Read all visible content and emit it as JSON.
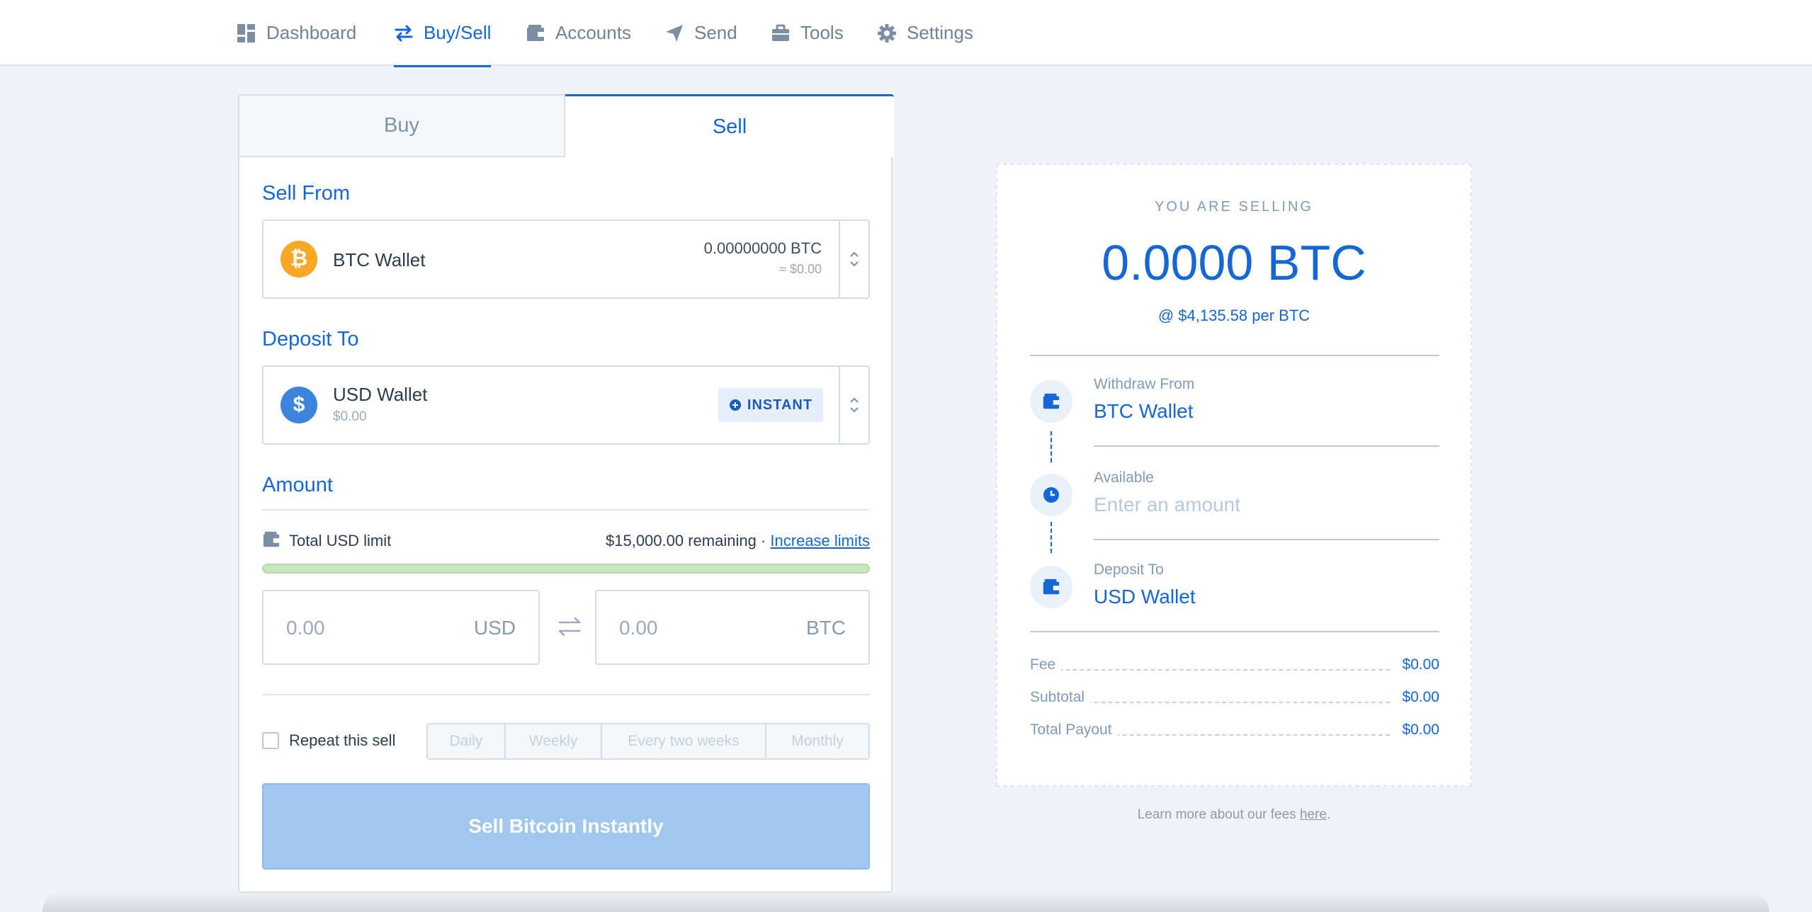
{
  "nav": {
    "items": [
      {
        "label": "Dashboard",
        "icon": "dashboard-icon"
      },
      {
        "label": "Buy/Sell",
        "icon": "exchange-icon",
        "active": true
      },
      {
        "label": "Accounts",
        "icon": "wallet-icon"
      },
      {
        "label": "Send",
        "icon": "paper-plane-icon"
      },
      {
        "label": "Tools",
        "icon": "briefcase-icon"
      },
      {
        "label": "Settings",
        "icon": "gear-icon"
      }
    ]
  },
  "tabs": {
    "buy": "Buy",
    "sell": "Sell",
    "active": "Sell"
  },
  "sell_from": {
    "title": "Sell From",
    "wallet": "BTC Wallet",
    "coin_symbol": "₿",
    "balance": "0.00000000 BTC",
    "balance_fiat": "≈ $0.00"
  },
  "deposit_to": {
    "title": "Deposit To",
    "wallet": "USD Wallet",
    "coin_symbol": "$",
    "balance": "$0.00",
    "badge": "INSTANT"
  },
  "amount": {
    "title": "Amount",
    "limit_label": "Total USD limit",
    "limit_remaining": "$15,000.00 remaining",
    "separator": "·",
    "increase_link": "Increase limits",
    "usd_value": "0.00",
    "usd_currency": "USD",
    "btc_value": "0.00",
    "btc_currency": "BTC"
  },
  "repeat": {
    "label": "Repeat this sell",
    "checked": false,
    "options": [
      "Daily",
      "Weekly",
      "Every two weeks",
      "Monthly"
    ]
  },
  "submit_label": "Sell Bitcoin Instantly",
  "summary": {
    "heading": "YOU ARE SELLING",
    "amount": "0.0000 BTC",
    "rate": "@ $4,135.58 per BTC",
    "steps": [
      {
        "label": "Withdraw From",
        "value": "BTC Wallet",
        "icon": "wallet-icon"
      },
      {
        "label": "Available",
        "value": "Enter an amount",
        "icon": "clock-icon",
        "placeholder": true
      },
      {
        "label": "Deposit To",
        "value": "USD Wallet",
        "icon": "wallet-icon"
      }
    ],
    "fees": [
      {
        "label": "Fee",
        "value": "$0.00"
      },
      {
        "label": "Subtotal",
        "value": "$0.00"
      },
      {
        "label": "Total Payout",
        "value": "$0.00"
      }
    ]
  },
  "footer": {
    "learn_more": "Learn more about our fees ",
    "link": "here",
    "period": "."
  },
  "colors": {
    "accent": "#1566d6",
    "background": "#eff3f7",
    "btc": "#f7a824",
    "usd": "#3b85dd",
    "progress": "#c8e6bf",
    "button_disabled": "#a0c8ef"
  }
}
